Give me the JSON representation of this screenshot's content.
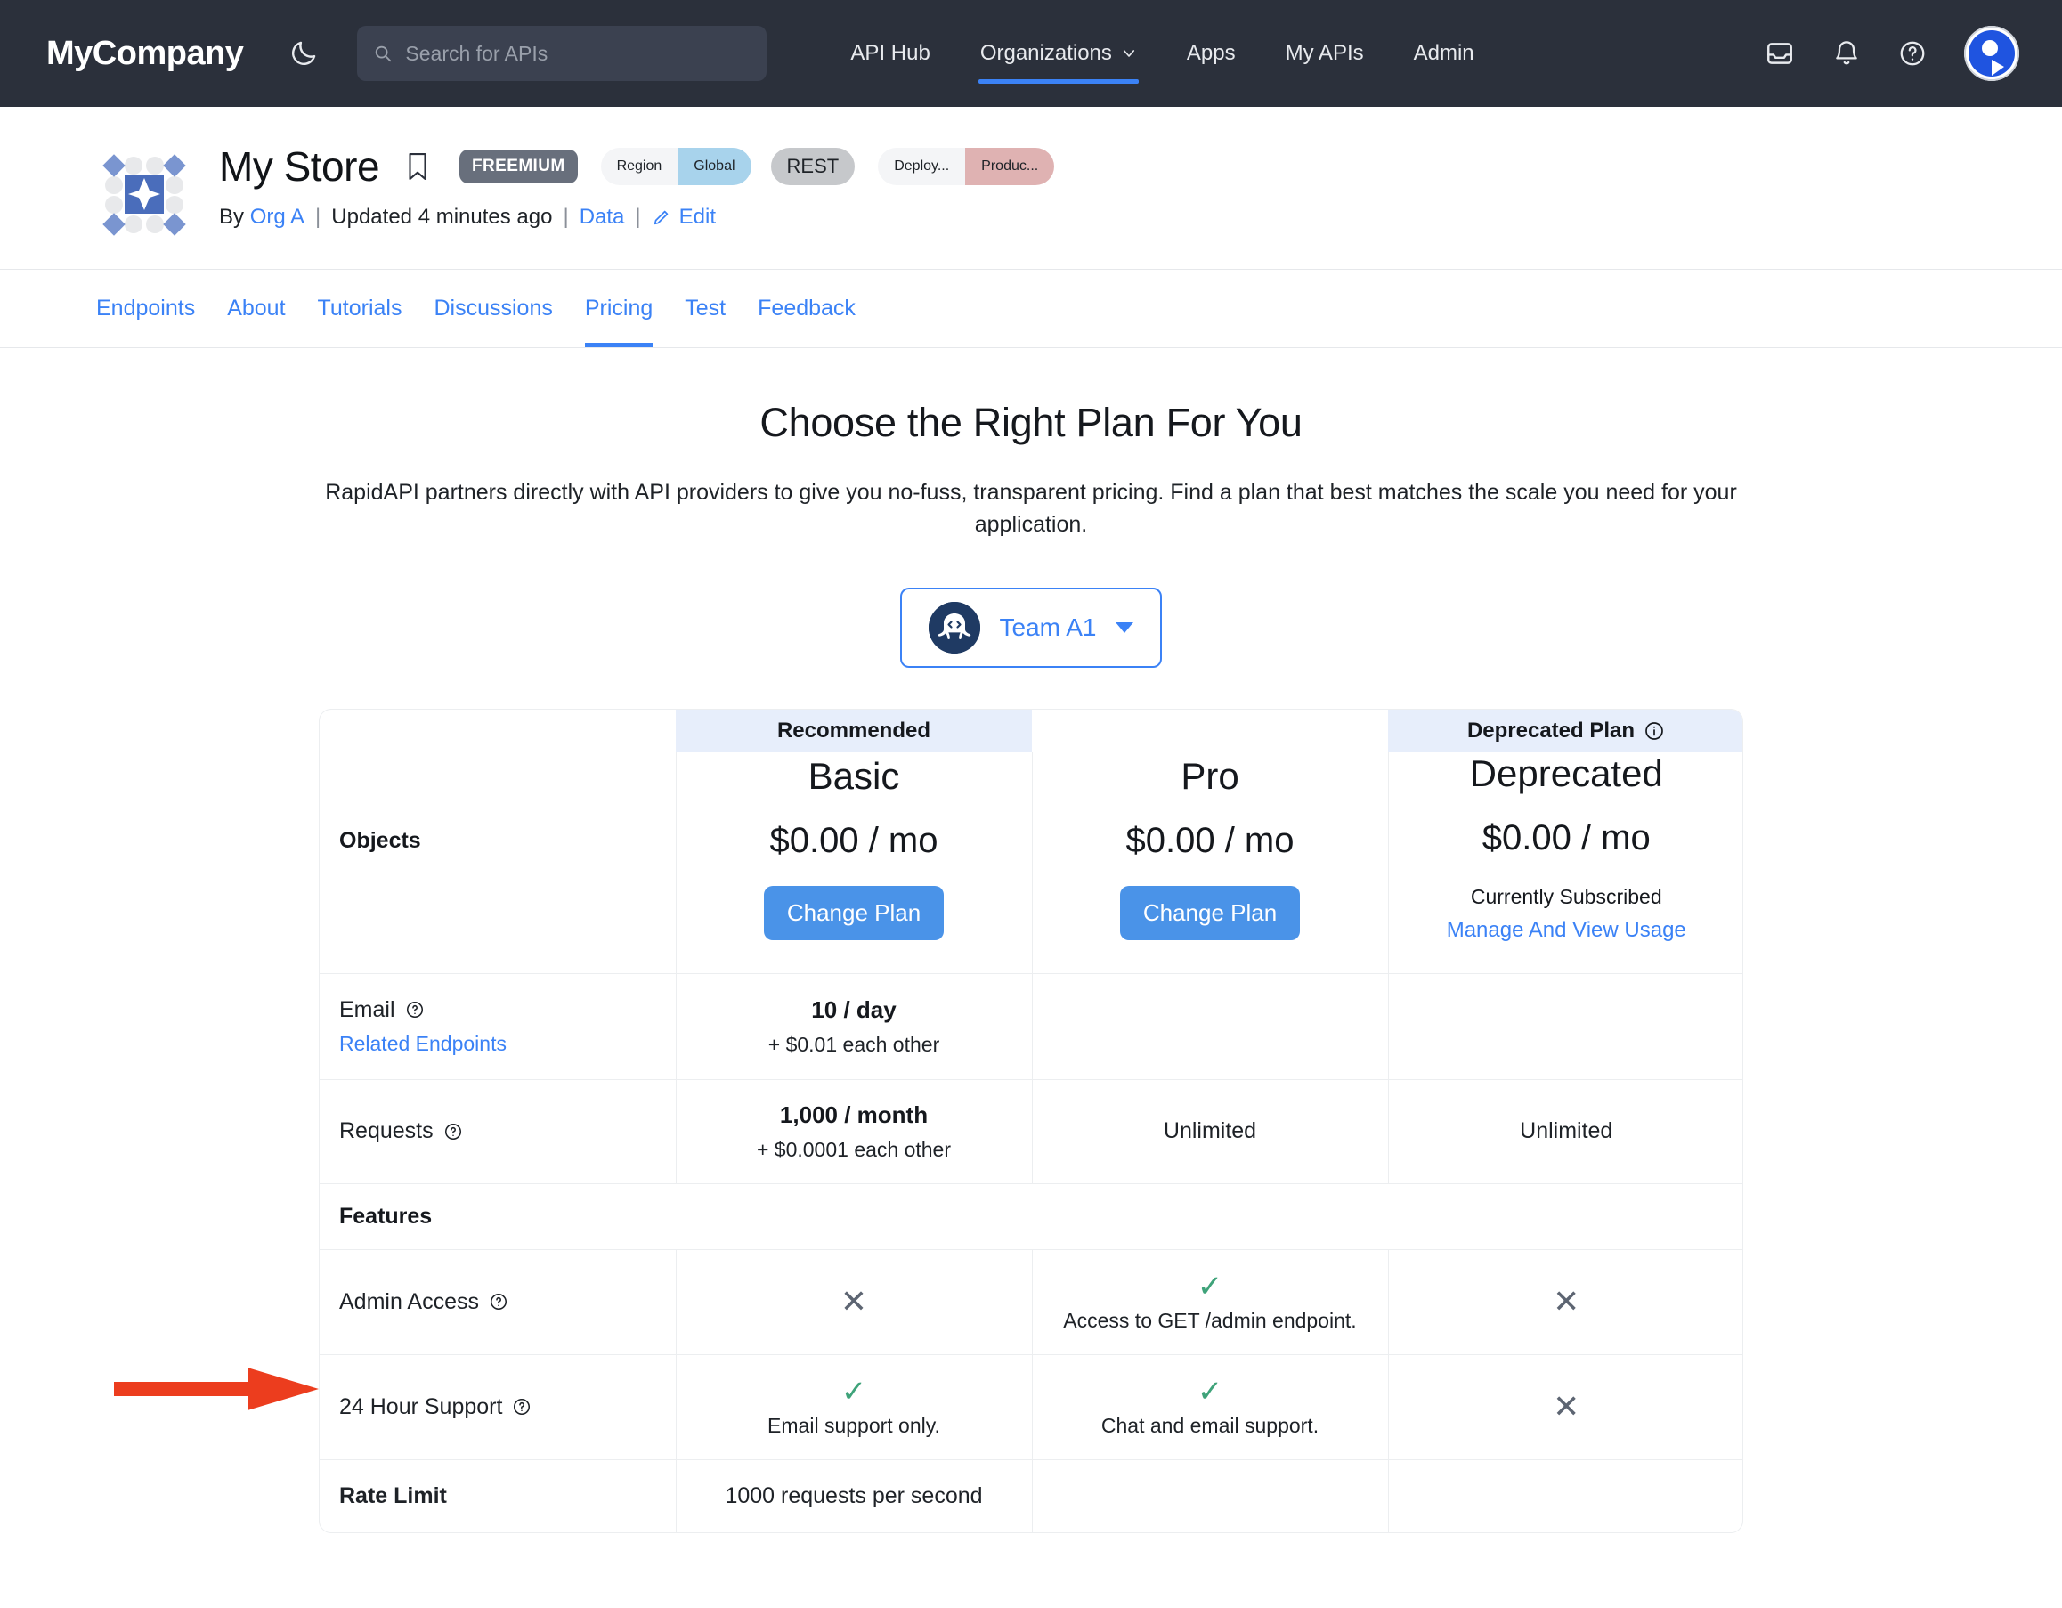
{
  "navbar": {
    "brand": "MyCompany",
    "theme_toggle_icon": "moon-icon",
    "search": {
      "placeholder": "Search for APIs",
      "value": "",
      "icon": "search-icon"
    },
    "links": [
      {
        "label": "API Hub",
        "active": false,
        "has_caret": false
      },
      {
        "label": "Organizations",
        "active": true,
        "has_caret": true
      },
      {
        "label": "Apps",
        "active": false,
        "has_caret": false
      },
      {
        "label": "My APIs",
        "active": false,
        "has_caret": false
      },
      {
        "label": "Admin",
        "active": false,
        "has_caret": false
      }
    ],
    "icons": [
      "inbox-icon",
      "bell-icon",
      "help-circle-icon"
    ],
    "avatar": "user-avatar",
    "active_underline_color": "#3b82f6",
    "background_color": "#2b303b"
  },
  "api_header": {
    "logo": "my-store-logo",
    "title": "My Store",
    "bookmark_icon": "bookmark-icon",
    "freemium_badge": "FREEMIUM",
    "region_key": "Region",
    "region_value": "Global",
    "rest_badge": "REST",
    "deploy_key": "Deploy...",
    "deploy_value": "Produc...",
    "by_label": "By",
    "org": "Org A",
    "updated": "Updated 4 minutes ago",
    "data_link": "Data",
    "edit_link": "Edit",
    "edit_icon": "pencil-icon"
  },
  "tabs": [
    {
      "label": "Endpoints",
      "active": false
    },
    {
      "label": "About",
      "active": false
    },
    {
      "label": "Tutorials",
      "active": false
    },
    {
      "label": "Discussions",
      "active": false
    },
    {
      "label": "Pricing",
      "active": true
    },
    {
      "label": "Test",
      "active": false
    },
    {
      "label": "Feedback",
      "active": false
    }
  ],
  "main": {
    "title": "Choose the Right Plan For You",
    "description": "RapidAPI partners directly with API providers to give you no-fuss, transparent pricing. Find a plan that best matches the scale you need for your application.",
    "team_selector": {
      "name": "Team A1",
      "avatar_icon": "octopus-code-icon",
      "caret_icon": "chevron-down-icon"
    }
  },
  "pricing": {
    "first_column_label": "Objects",
    "column_headers": [
      {
        "label": "Recommended",
        "highlighted": true,
        "info_icon": false
      },
      {
        "label": "",
        "highlighted": false,
        "info_icon": false
      },
      {
        "label": "Deprecated Plan",
        "highlighted": true,
        "info_icon": true
      }
    ],
    "plans": [
      {
        "name": "Basic",
        "price": "$0.00 / mo",
        "cta": "Change Plan",
        "subscribed_note": "",
        "manage_link": ""
      },
      {
        "name": "Pro",
        "price": "$0.00 / mo",
        "cta": "Change Plan",
        "subscribed_note": "",
        "manage_link": ""
      },
      {
        "name": "Deprecated",
        "price": "$0.00 / mo",
        "cta": "",
        "subscribed_note": "Currently Subscribed",
        "manage_link": "Manage And View Usage"
      }
    ],
    "rows": [
      {
        "kind": "quota",
        "label": "Email",
        "has_info": true,
        "sub_link": "Related Endpoints",
        "cells": [
          {
            "main": "10 / day",
            "sub": "+ $0.01 each other"
          },
          {
            "main": "",
            "sub": ""
          },
          {
            "main": "",
            "sub": ""
          }
        ]
      },
      {
        "kind": "quota",
        "label": "Requests",
        "has_info": true,
        "sub_link": "",
        "cells": [
          {
            "main": "1,000 / month",
            "sub": "+ $0.0001 each other"
          },
          {
            "plain": "Unlimited"
          },
          {
            "plain": "Unlimited"
          }
        ]
      },
      {
        "kind": "section",
        "label": "Features"
      },
      {
        "kind": "feature",
        "label": "Admin Access",
        "has_info": true,
        "cells": [
          {
            "icon": "cross",
            "note": ""
          },
          {
            "icon": "check",
            "note": "Access to GET /admin endpoint."
          },
          {
            "icon": "cross",
            "note": ""
          }
        ]
      },
      {
        "kind": "feature",
        "label": "24 Hour Support",
        "has_info": true,
        "cells": [
          {
            "icon": "check",
            "note": "Email support only."
          },
          {
            "icon": "check",
            "note": "Chat and email support."
          },
          {
            "icon": "cross",
            "note": ""
          }
        ]
      },
      {
        "kind": "plainrow",
        "label": "Rate Limit",
        "has_info": false,
        "bold_label": true,
        "cells": [
          {
            "plain": "1000 requests per second"
          },
          {
            "plain": ""
          },
          {
            "plain": ""
          }
        ]
      }
    ]
  },
  "annotation": {
    "arrow_color": "#ec3d1e",
    "points_to": "Admin Access"
  },
  "colors": {
    "accent_blue": "#3b82f6",
    "button_blue": "#4a93e8",
    "header_highlight": "#e7eefb",
    "check_green": "#3fa37a",
    "cross_gray": "#5d6572",
    "navbar_bg": "#2b303b"
  }
}
